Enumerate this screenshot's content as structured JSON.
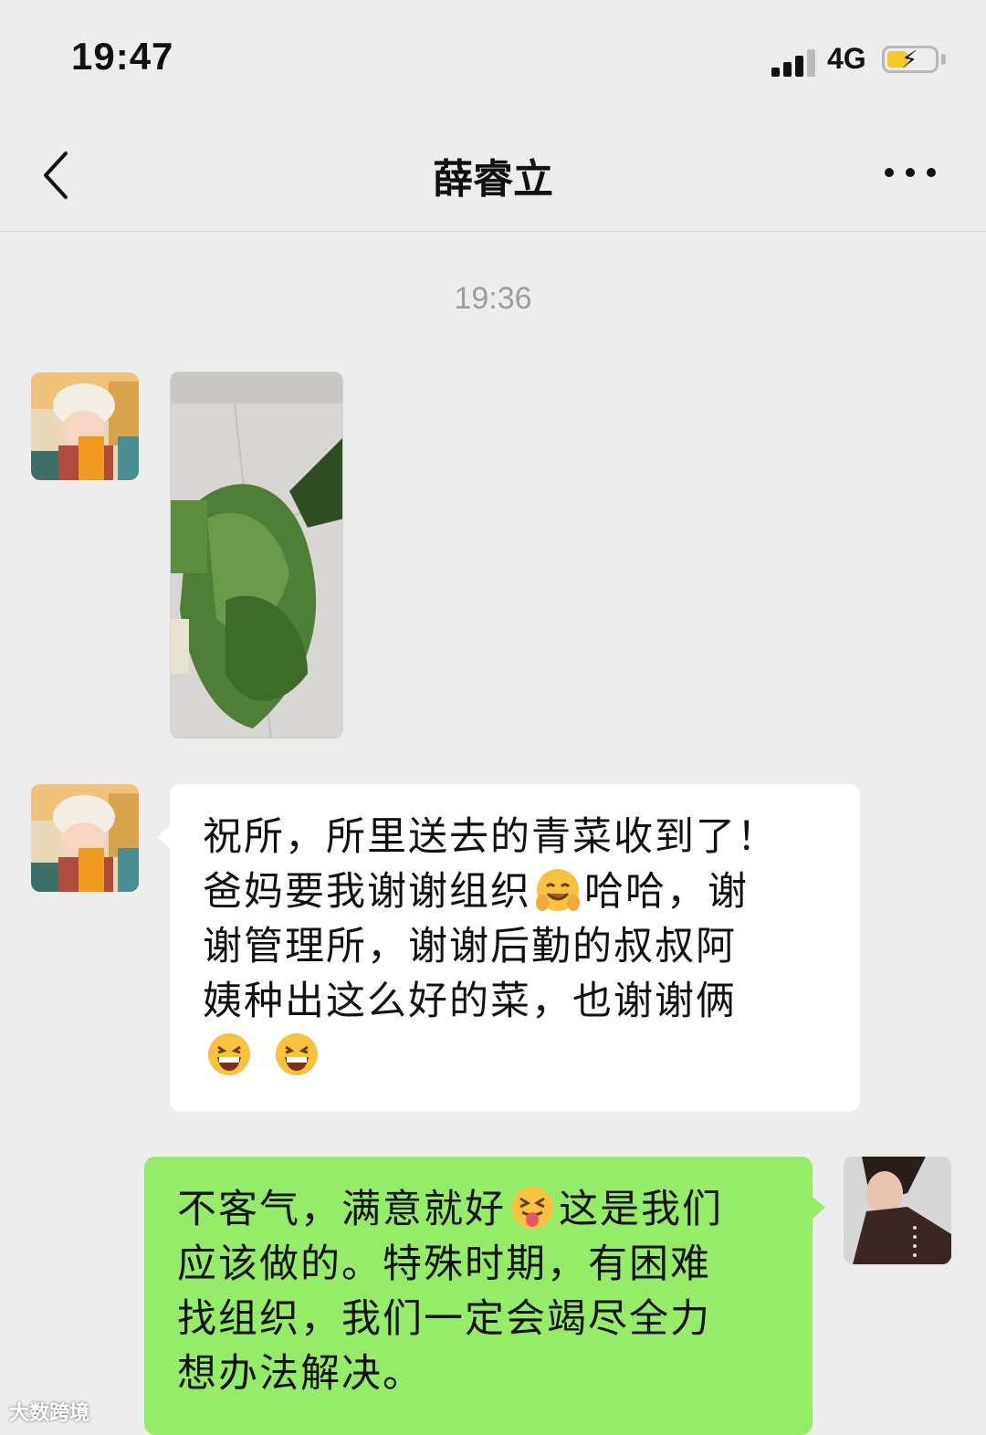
{
  "status_bar": {
    "time": "19:47",
    "network": "4G"
  },
  "chat": {
    "title": "薛睿立"
  },
  "timestamp": "19:36",
  "messages": [
    {
      "sender": "contact",
      "type": "image"
    },
    {
      "sender": "contact",
      "type": "text",
      "lines": [
        {
          "parts": [
            "祝所，所里送去的青菜收到了！"
          ]
        },
        {
          "parts": [
            "爸妈要我谢谢组织",
            "哈哈，谢"
          ],
          "emoji": "smile-hands-emoji"
        },
        {
          "parts": [
            "谢管理所，谢谢后勤的叔叔阿"
          ]
        },
        {
          "parts": [
            "姨种出这么好的菜，也谢谢俩"
          ]
        }
      ],
      "trailing_emojis": [
        "grin-emoji",
        "grin-emoji"
      ]
    },
    {
      "sender": "me",
      "type": "text",
      "lines": [
        {
          "parts": [
            "不客气，满意就好",
            "这是我们"
          ],
          "emoji": "tongue-emoji"
        },
        {
          "parts": [
            "应该做的。特殊时期，有困难"
          ]
        },
        {
          "parts": [
            "找组织，我们一定会竭尽全力"
          ]
        },
        {
          "parts": [
            "想办法解决。"
          ]
        }
      ]
    }
  ],
  "watermark": "大数跨境",
  "colors": {
    "background": "#ededed",
    "outgoing_bubble": "#95ec69",
    "incoming_bubble": "#ffffff",
    "battery": "#f6c829"
  }
}
